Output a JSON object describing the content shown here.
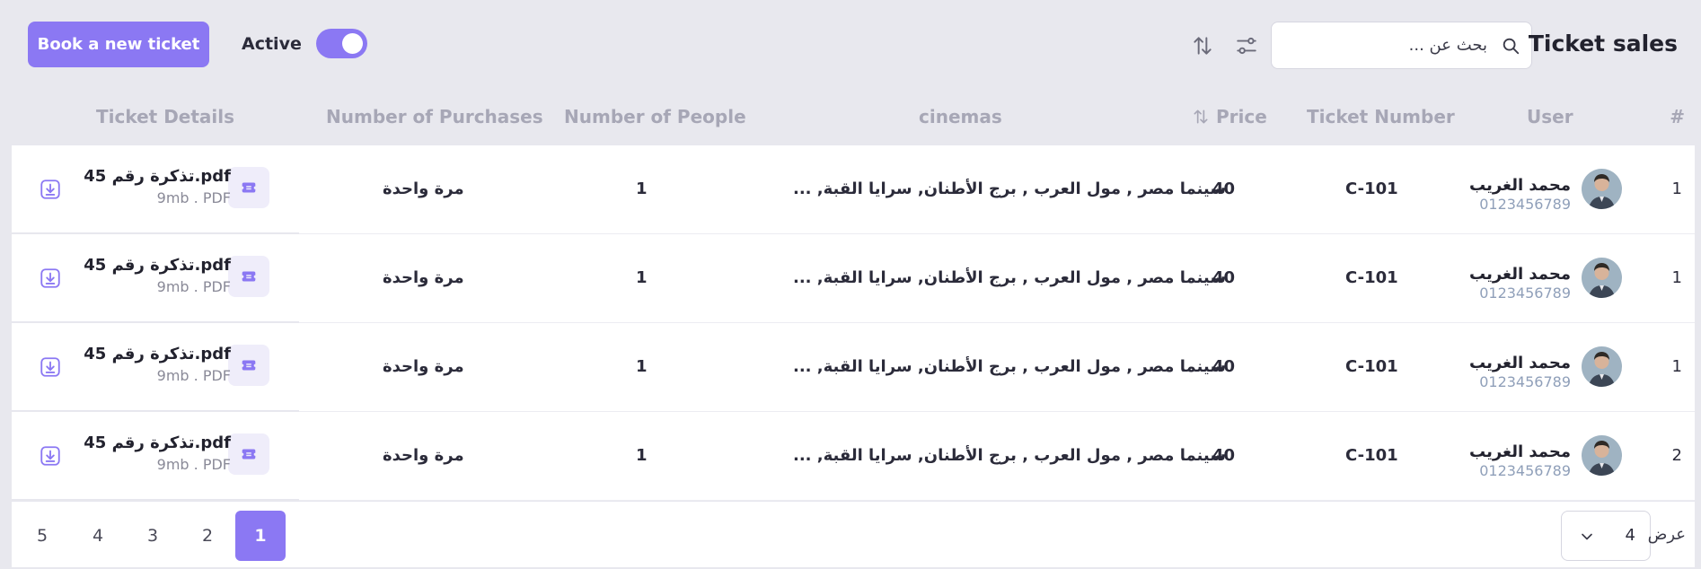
{
  "header": {
    "title": "Ticket sales",
    "book_label": "Book a new ticket",
    "active_label": "Active",
    "active_on": true,
    "search_placeholder": "بحث عن ..."
  },
  "columns": {
    "num": "#",
    "user": "User",
    "ticket_number": "Ticket Number",
    "price": "Price",
    "cinemas": "cinemas",
    "people": "Number of People",
    "purchases": "Number of Purchases",
    "details": "Ticket Details"
  },
  "rows": [
    {
      "num": "1",
      "name": "محمد الغريب",
      "phone": "0123456789",
      "ticket": "C-101",
      "price": "40",
      "cinemas": "سينما مصر , مول العرب , برج الأطنان, سرايا القبة, ...",
      "people": "1",
      "purchases": "مرة واحدة",
      "file_name": "تذكرة رقم 45.pdf",
      "file_size": "9mb . PDF"
    },
    {
      "num": "1",
      "name": "محمد الغريب",
      "phone": "0123456789",
      "ticket": "C-101",
      "price": "40",
      "cinemas": "سينما مصر , مول العرب , برج الأطنان, سرايا القبة, ...",
      "people": "1",
      "purchases": "مرة واحدة",
      "file_name": "تذكرة رقم 45.pdf",
      "file_size": "9mb . PDF"
    },
    {
      "num": "1",
      "name": "محمد الغريب",
      "phone": "0123456789",
      "ticket": "C-101",
      "price": "40",
      "cinemas": "سينما مصر , مول العرب , برج الأطنان, سرايا القبة, ...",
      "people": "1",
      "purchases": "مرة واحدة",
      "file_name": "تذكرة رقم 45.pdf",
      "file_size": "9mb . PDF"
    },
    {
      "num": "2",
      "name": "محمد الغريب",
      "phone": "0123456789",
      "ticket": "C-101",
      "price": "40",
      "cinemas": "سينما مصر , مول العرب , برج الأطنان, سرايا القبة, ...",
      "people": "1",
      "purchases": "مرة واحدة",
      "file_name": "تذكرة رقم 45.pdf",
      "file_size": "9mb . PDF"
    }
  ],
  "pagination": {
    "pages": [
      "1",
      "2",
      "3",
      "4",
      "5"
    ],
    "current": "1",
    "show_label": "عرض",
    "per_page": "4"
  },
  "colors": {
    "accent": "#8b78f3",
    "background": "#e8e8ee",
    "muted_header": "#a7a7b6",
    "phone": "#8f9fb9"
  },
  "icons": {
    "search": "search-icon",
    "filter": "sliders-icon",
    "sort": "sort-icon",
    "download": "download-icon",
    "ticket": "ticket-icon",
    "chevron": "chevron-down-icon"
  }
}
